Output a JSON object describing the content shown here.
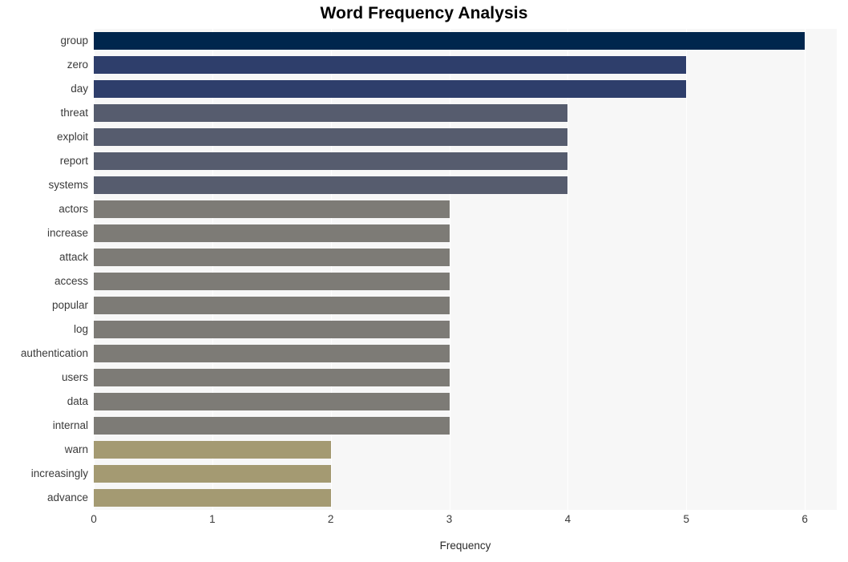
{
  "chart_data": {
    "type": "bar",
    "orientation": "horizontal",
    "title": "Word Frequency Analysis",
    "xlabel": "Frequency",
    "ylabel": "",
    "xlim": [
      0,
      6.27
    ],
    "xticks": [
      0,
      1,
      2,
      3,
      4,
      5,
      6
    ],
    "xtick_labels": [
      "0",
      "1",
      "2",
      "3",
      "4",
      "5",
      "6"
    ],
    "grid": true,
    "grid_axis": "x",
    "legend": false,
    "categories": [
      "group",
      "zero",
      "day",
      "threat",
      "exploit",
      "report",
      "systems",
      "actors",
      "increase",
      "attack",
      "access",
      "popular",
      "log",
      "authentication",
      "users",
      "data",
      "internal",
      "warn",
      "increasingly",
      "advance"
    ],
    "values": [
      6,
      5,
      5,
      4,
      4,
      4,
      4,
      3,
      3,
      3,
      3,
      3,
      3,
      3,
      3,
      3,
      3,
      2,
      2,
      2
    ],
    "bar_colors": [
      "#00264d",
      "#2e3e6b",
      "#2e3e6b",
      "#565c6e",
      "#565c6e",
      "#565c6e",
      "#565c6e",
      "#7d7b76",
      "#7d7b76",
      "#7d7b76",
      "#7d7b76",
      "#7d7b76",
      "#7d7b76",
      "#7d7b76",
      "#7d7b76",
      "#7d7b76",
      "#7d7b76",
      "#a49a72",
      "#a49a72",
      "#a49a72"
    ]
  },
  "style": {
    "plot_background": "#f7f7f7",
    "figure_background": "#ffffff",
    "gridline_color": "#ffffff",
    "tick_label_color": "#3a3a3a",
    "title_color": "#000000"
  }
}
